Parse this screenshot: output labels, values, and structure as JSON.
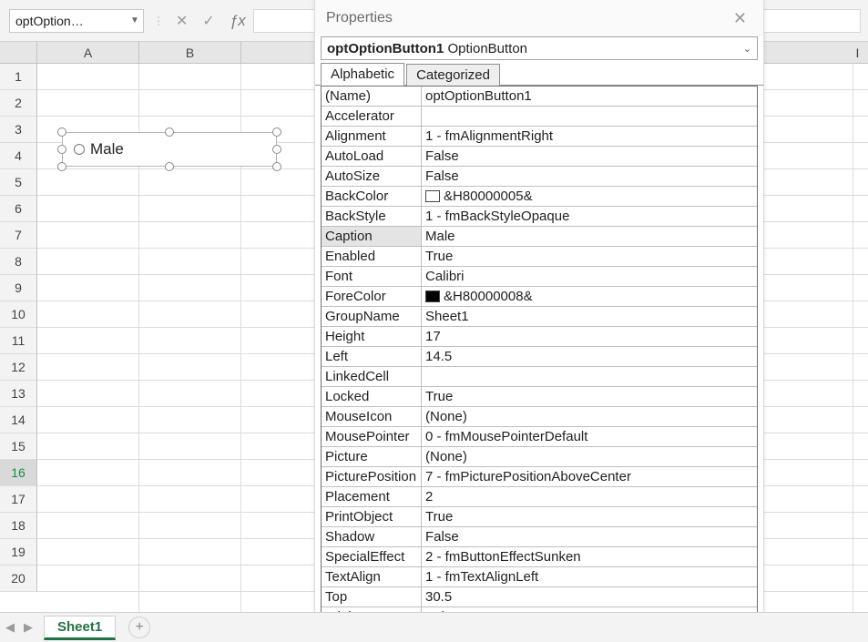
{
  "toolbar": {
    "namebox": "optOption…",
    "cancel_glyph": "✕",
    "accept_glyph": "✓",
    "fx_label": "ƒx"
  },
  "columns": [
    "A",
    "B",
    "I"
  ],
  "rows": [
    "1",
    "2",
    "3",
    "4",
    "5",
    "6",
    "7",
    "8",
    "9",
    "10",
    "11",
    "12",
    "13",
    "14",
    "15",
    "16",
    "17",
    "18",
    "19",
    "20"
  ],
  "control": {
    "label": "Male"
  },
  "properties": {
    "title": "Properties",
    "selector_bold": "optOptionButton1",
    "selector_rest": " OptionButton",
    "tab_alpha": "Alphabetic",
    "tab_cat": "Categorized",
    "rows": [
      {
        "k": "(Name)",
        "v": "optOptionButton1"
      },
      {
        "k": "Accelerator",
        "v": ""
      },
      {
        "k": "Alignment",
        "v": "1 - fmAlignmentRight"
      },
      {
        "k": "AutoLoad",
        "v": "False"
      },
      {
        "k": "AutoSize",
        "v": "False"
      },
      {
        "k": "BackColor",
        "v": "&H80000005&",
        "swatch": "#ffffff"
      },
      {
        "k": "BackStyle",
        "v": "1 - fmBackStyleOpaque"
      },
      {
        "k": "Caption",
        "v": "Male",
        "sel": true
      },
      {
        "k": "Enabled",
        "v": "True"
      },
      {
        "k": "Font",
        "v": "Calibri"
      },
      {
        "k": "ForeColor",
        "v": "&H80000008&",
        "swatch": "#000000"
      },
      {
        "k": "GroupName",
        "v": "Sheet1"
      },
      {
        "k": "Height",
        "v": "17"
      },
      {
        "k": "Left",
        "v": "14.5"
      },
      {
        "k": "LinkedCell",
        "v": ""
      },
      {
        "k": "Locked",
        "v": "True"
      },
      {
        "k": "MouseIcon",
        "v": "(None)"
      },
      {
        "k": "MousePointer",
        "v": "0 - fmMousePointerDefault"
      },
      {
        "k": "Picture",
        "v": "(None)"
      },
      {
        "k": "PicturePosition",
        "v": "7 - fmPicturePositionAboveCenter"
      },
      {
        "k": "Placement",
        "v": "2"
      },
      {
        "k": "PrintObject",
        "v": "True"
      },
      {
        "k": "Shadow",
        "v": "False"
      },
      {
        "k": "SpecialEffect",
        "v": "2 - fmButtonEffectSunken"
      },
      {
        "k": "TextAlign",
        "v": "1 - fmTextAlignLeft"
      },
      {
        "k": "Top",
        "v": "30.5"
      },
      {
        "k": "TripleState",
        "v": "False"
      }
    ]
  },
  "sheettab": "Sheet1"
}
